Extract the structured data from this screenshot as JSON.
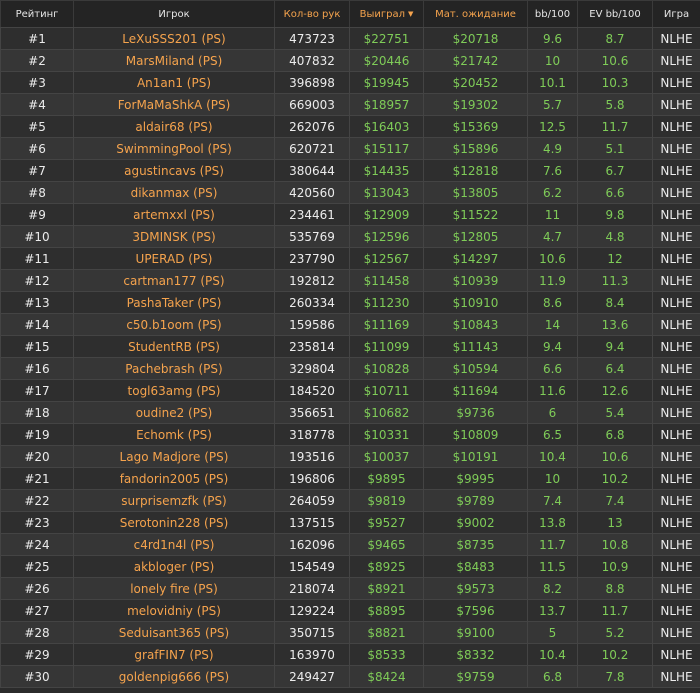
{
  "headers": {
    "rank": "Рейтинг",
    "player": "Игрок",
    "hands": "Кол-во рук",
    "won": "Выиграл",
    "ev": "Мат. ожидание",
    "bb100": "bb/100",
    "evbb100": "EV bb/100",
    "game": "Игра"
  },
  "sort_arrow_icon": "caret-down-icon",
  "colors": {
    "accent_orange": "#f5a34d",
    "positive_green": "#7fcc58",
    "text_light": "#ececec",
    "row_odd": "#2e2e2e",
    "row_even": "#363636"
  },
  "rows": [
    {
      "rank": "#1",
      "player": "LeXuSSS201 (PS)",
      "hands": "473723",
      "won": "$22751",
      "ev": "$20718",
      "bb": "9.6",
      "evbb": "8.7",
      "game": "NLHE"
    },
    {
      "rank": "#2",
      "player": "MarsMiland (PS)",
      "hands": "407832",
      "won": "$20446",
      "ev": "$21742",
      "bb": "10",
      "evbb": "10.6",
      "game": "NLHE"
    },
    {
      "rank": "#3",
      "player": "An1an1 (PS)",
      "hands": "396898",
      "won": "$19945",
      "ev": "$20452",
      "bb": "10.1",
      "evbb": "10.3",
      "game": "NLHE"
    },
    {
      "rank": "#4",
      "player": "ForMaMaShkA (PS)",
      "hands": "669003",
      "won": "$18957",
      "ev": "$19302",
      "bb": "5.7",
      "evbb": "5.8",
      "game": "NLHE"
    },
    {
      "rank": "#5",
      "player": "aldair68 (PS)",
      "hands": "262076",
      "won": "$16403",
      "ev": "$15369",
      "bb": "12.5",
      "evbb": "11.7",
      "game": "NLHE"
    },
    {
      "rank": "#6",
      "player": "SwimmingPool (PS)",
      "hands": "620721",
      "won": "$15117",
      "ev": "$15896",
      "bb": "4.9",
      "evbb": "5.1",
      "game": "NLHE"
    },
    {
      "rank": "#7",
      "player": "agustincavs (PS)",
      "hands": "380644",
      "won": "$14435",
      "ev": "$12818",
      "bb": "7.6",
      "evbb": "6.7",
      "game": "NLHE"
    },
    {
      "rank": "#8",
      "player": "dikanmax (PS)",
      "hands": "420560",
      "won": "$13043",
      "ev": "$13805",
      "bb": "6.2",
      "evbb": "6.6",
      "game": "NLHE"
    },
    {
      "rank": "#9",
      "player": "artemxxl (PS)",
      "hands": "234461",
      "won": "$12909",
      "ev": "$11522",
      "bb": "11",
      "evbb": "9.8",
      "game": "NLHE"
    },
    {
      "rank": "#10",
      "player": "3DMINSK (PS)",
      "hands": "535769",
      "won": "$12596",
      "ev": "$12805",
      "bb": "4.7",
      "evbb": "4.8",
      "game": "NLHE"
    },
    {
      "rank": "#11",
      "player": "UPERAD (PS)",
      "hands": "237790",
      "won": "$12567",
      "ev": "$14297",
      "bb": "10.6",
      "evbb": "12",
      "game": "NLHE"
    },
    {
      "rank": "#12",
      "player": "cartman177 (PS)",
      "hands": "192812",
      "won": "$11458",
      "ev": "$10939",
      "bb": "11.9",
      "evbb": "11.3",
      "game": "NLHE"
    },
    {
      "rank": "#13",
      "player": "PashaTaker (PS)",
      "hands": "260334",
      "won": "$11230",
      "ev": "$10910",
      "bb": "8.6",
      "evbb": "8.4",
      "game": "NLHE"
    },
    {
      "rank": "#14",
      "player": "c50.b1oom (PS)",
      "hands": "159586",
      "won": "$11169",
      "ev": "$10843",
      "bb": "14",
      "evbb": "13.6",
      "game": "NLHE"
    },
    {
      "rank": "#15",
      "player": "StudentRB (PS)",
      "hands": "235814",
      "won": "$11099",
      "ev": "$11143",
      "bb": "9.4",
      "evbb": "9.4",
      "game": "NLHE"
    },
    {
      "rank": "#16",
      "player": "Pachebrash (PS)",
      "hands": "329804",
      "won": "$10828",
      "ev": "$10594",
      "bb": "6.6",
      "evbb": "6.4",
      "game": "NLHE"
    },
    {
      "rank": "#17",
      "player": "togl63amg (PS)",
      "hands": "184520",
      "won": "$10711",
      "ev": "$11694",
      "bb": "11.6",
      "evbb": "12.6",
      "game": "NLHE"
    },
    {
      "rank": "#18",
      "player": "oudine2 (PS)",
      "hands": "356651",
      "won": "$10682",
      "ev": "$9736",
      "bb": "6",
      "evbb": "5.4",
      "game": "NLHE"
    },
    {
      "rank": "#19",
      "player": "Echomk (PS)",
      "hands": "318778",
      "won": "$10331",
      "ev": "$10809",
      "bb": "6.5",
      "evbb": "6.8",
      "game": "NLHE"
    },
    {
      "rank": "#20",
      "player": "Lago Madjore (PS)",
      "hands": "193516",
      "won": "$10037",
      "ev": "$10191",
      "bb": "10.4",
      "evbb": "10.6",
      "game": "NLHE"
    },
    {
      "rank": "#21",
      "player": "fandorin2005 (PS)",
      "hands": "196806",
      "won": "$9895",
      "ev": "$9995",
      "bb": "10",
      "evbb": "10.2",
      "game": "NLHE"
    },
    {
      "rank": "#22",
      "player": "surprisemzfk (PS)",
      "hands": "264059",
      "won": "$9819",
      "ev": "$9789",
      "bb": "7.4",
      "evbb": "7.4",
      "game": "NLHE"
    },
    {
      "rank": "#23",
      "player": "Serotonin228 (PS)",
      "hands": "137515",
      "won": "$9527",
      "ev": "$9002",
      "bb": "13.8",
      "evbb": "13",
      "game": "NLHE"
    },
    {
      "rank": "#24",
      "player": "c4rd1n4l (PS)",
      "hands": "162096",
      "won": "$9465",
      "ev": "$8735",
      "bb": "11.7",
      "evbb": "10.8",
      "game": "NLHE"
    },
    {
      "rank": "#25",
      "player": "akbloger (PS)",
      "hands": "154549",
      "won": "$8925",
      "ev": "$8483",
      "bb": "11.5",
      "evbb": "10.9",
      "game": "NLHE"
    },
    {
      "rank": "#26",
      "player": "lonely fire (PS)",
      "hands": "218074",
      "won": "$8921",
      "ev": "$9573",
      "bb": "8.2",
      "evbb": "8.8",
      "game": "NLHE"
    },
    {
      "rank": "#27",
      "player": "melovidniy (PS)",
      "hands": "129224",
      "won": "$8895",
      "ev": "$7596",
      "bb": "13.7",
      "evbb": "11.7",
      "game": "NLHE"
    },
    {
      "rank": "#28",
      "player": "Seduisant365 (PS)",
      "hands": "350715",
      "won": "$8821",
      "ev": "$9100",
      "bb": "5",
      "evbb": "5.2",
      "game": "NLHE"
    },
    {
      "rank": "#29",
      "player": "grafFIN7 (PS)",
      "hands": "163970",
      "won": "$8533",
      "ev": "$8332",
      "bb": "10.4",
      "evbb": "10.2",
      "game": "NLHE"
    },
    {
      "rank": "#30",
      "player": "goldenpig666 (PS)",
      "hands": "249427",
      "won": "$8424",
      "ev": "$9759",
      "bb": "6.8",
      "evbb": "7.8",
      "game": "NLHE"
    }
  ]
}
